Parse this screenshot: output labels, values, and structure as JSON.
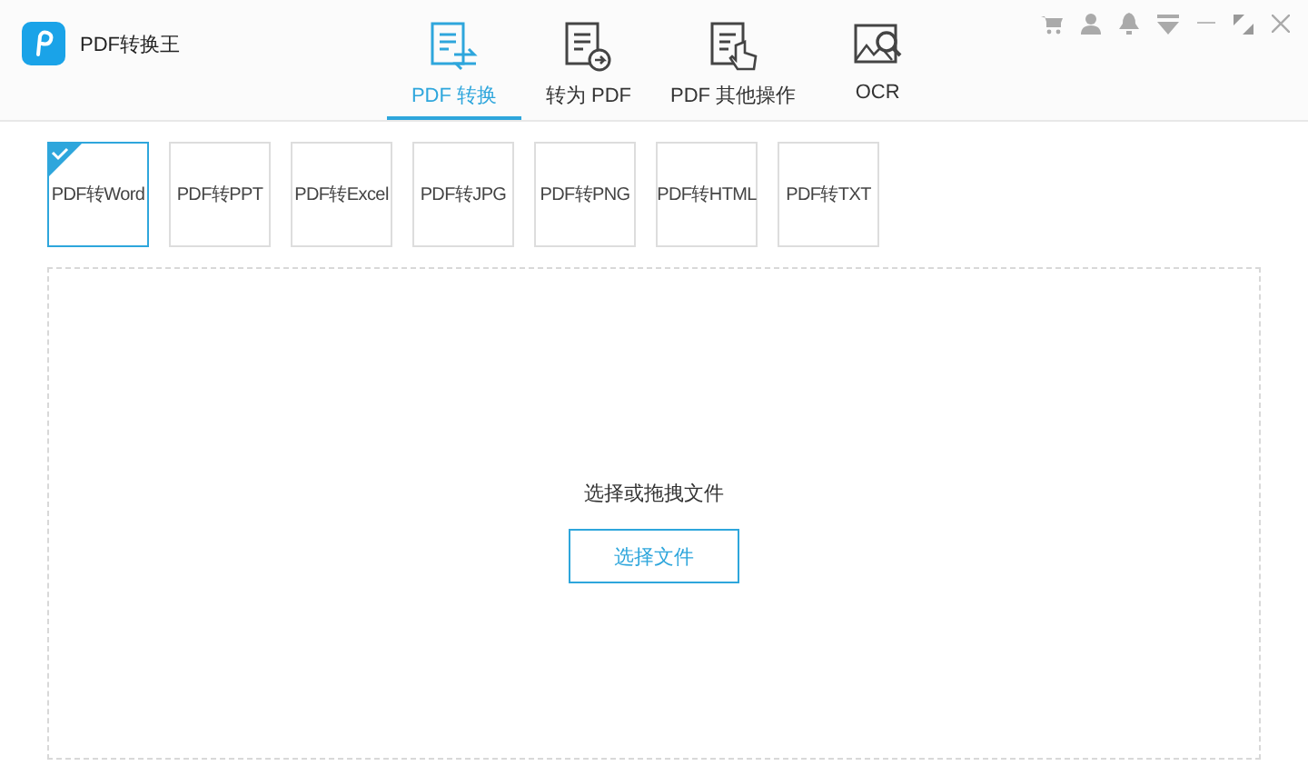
{
  "app": {
    "title": "PDF转换王"
  },
  "tabs": [
    {
      "label": "PDF 转换",
      "selected": true,
      "kind": "convert"
    },
    {
      "label": "转为 PDF",
      "selected": false,
      "kind": "topdf"
    },
    {
      "label": "PDF 其他操作",
      "selected": false,
      "kind": "other"
    },
    {
      "label": "OCR",
      "selected": false,
      "kind": "ocr"
    }
  ],
  "formats": [
    {
      "label": "PDF转Word",
      "selected": true
    },
    {
      "label": "PDF转PPT",
      "selected": false
    },
    {
      "label": "PDF转Excel",
      "selected": false
    },
    {
      "label": "PDF转JPG",
      "selected": false
    },
    {
      "label": "PDF转PNG",
      "selected": false
    },
    {
      "label": "PDF转HTML",
      "selected": false
    },
    {
      "label": "PDF转TXT",
      "selected": false
    }
  ],
  "drop_zone": {
    "hint": "选择或拖拽文件",
    "button": "选择文件"
  }
}
